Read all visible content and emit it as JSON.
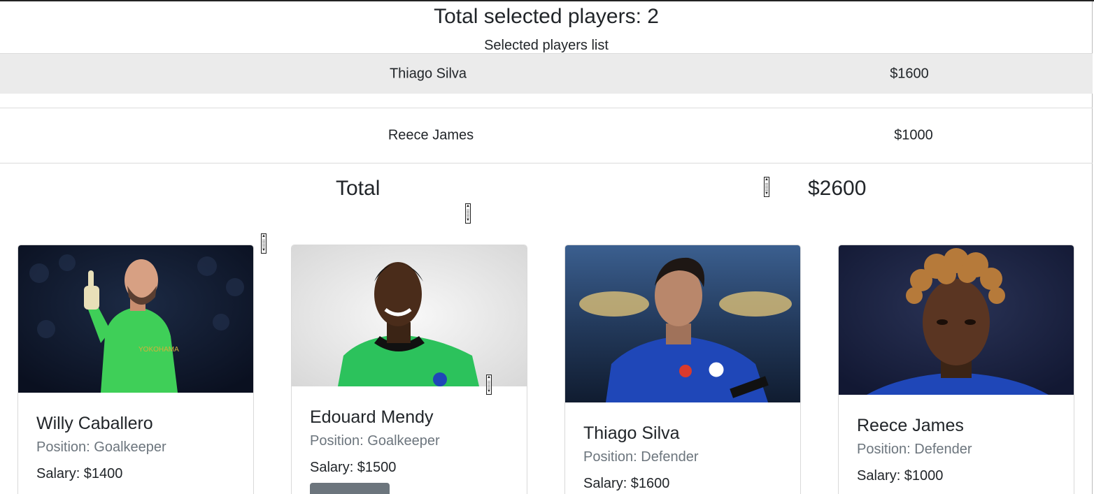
{
  "header": {
    "title": "Total selected players: 2",
    "subtitle": "Selected players list"
  },
  "selected": [
    {
      "name": "Thiago Silva",
      "salary": "$1600"
    },
    {
      "name": "Reece James",
      "salary": "$1000"
    }
  ],
  "total": {
    "label": "Total",
    "value": "$2600"
  },
  "players": [
    {
      "name": "Willy Caballero",
      "position": "Position: Goalkeeper",
      "salary": "Salary: $1400",
      "photo": "goalkeeper in green kit, thumbs up"
    },
    {
      "name": "Edouard Mendy",
      "position": "Position: Goalkeeper",
      "salary": "Salary: $1500",
      "photo": "goalkeeper in green kit, smiling"
    },
    {
      "name": "Thiago Silva",
      "position": "Position: Defender",
      "salary": "Salary: $1600",
      "photo": "defender in blue kit with captain armband"
    },
    {
      "name": "Reece James",
      "position": "Position: Defender",
      "salary": "Salary: $1000",
      "photo": "player in blue kit, curly hair"
    }
  ],
  "colors": {
    "shaded_row": "#ebebeb",
    "muted_text": "#6c757d",
    "kit_green": "#3fcf58",
    "kit_blue": "#1f47b8"
  }
}
